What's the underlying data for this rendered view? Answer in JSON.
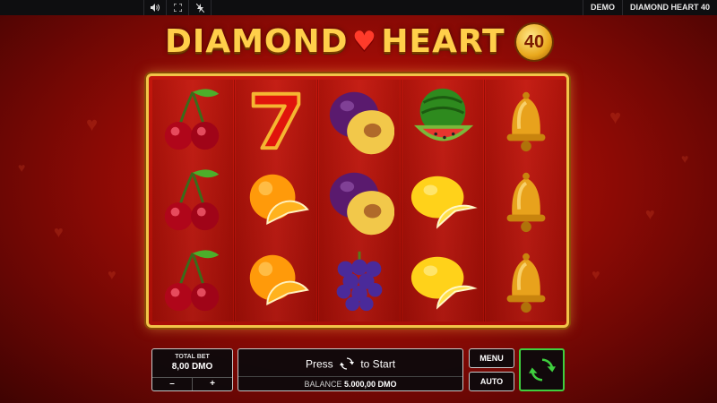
{
  "topbar": {
    "icons": [
      "sound-icon",
      "fullscreen-icon",
      "turbo-off-icon"
    ],
    "mode": "DEMO",
    "game_name": "DIAMOND HEART 40"
  },
  "title": {
    "text_before": "DIAMOND",
    "text_after": "HEART",
    "badge": "40"
  },
  "reels": [
    [
      "cherries",
      "cherries",
      "cherries"
    ],
    [
      "seven",
      "orange",
      "orange"
    ],
    [
      "plum",
      "plum",
      "grapes"
    ],
    [
      "watermelon",
      "lemon",
      "lemon"
    ],
    [
      "bell",
      "bell",
      "bell"
    ]
  ],
  "bet": {
    "label": "TOTAL BET",
    "value": "8,00 DMO",
    "minus": "–",
    "plus": "+"
  },
  "press": {
    "before": "Press",
    "after": "to Start"
  },
  "balance": {
    "label": "BALANCE",
    "value": "5.000,00 DMO"
  },
  "buttons": {
    "menu": "MENU",
    "auto": "AUTO"
  },
  "colors": {
    "accent_green": "#3fcf3f",
    "frame_gold": "#f2c449",
    "bg_red": "#a40d06"
  }
}
